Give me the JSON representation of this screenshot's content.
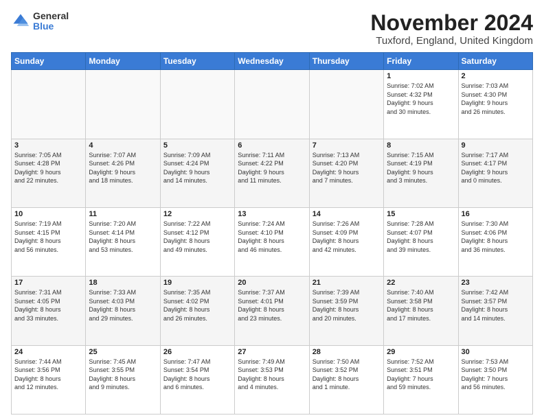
{
  "header": {
    "logo_general": "General",
    "logo_blue": "Blue",
    "month_title": "November 2024",
    "location": "Tuxford, England, United Kingdom"
  },
  "calendar": {
    "days_of_week": [
      "Sunday",
      "Monday",
      "Tuesday",
      "Wednesday",
      "Thursday",
      "Friday",
      "Saturday"
    ],
    "weeks": [
      [
        {
          "day": "",
          "info": ""
        },
        {
          "day": "",
          "info": ""
        },
        {
          "day": "",
          "info": ""
        },
        {
          "day": "",
          "info": ""
        },
        {
          "day": "",
          "info": ""
        },
        {
          "day": "1",
          "info": "Sunrise: 7:02 AM\nSunset: 4:32 PM\nDaylight: 9 hours\nand 30 minutes."
        },
        {
          "day": "2",
          "info": "Sunrise: 7:03 AM\nSunset: 4:30 PM\nDaylight: 9 hours\nand 26 minutes."
        }
      ],
      [
        {
          "day": "3",
          "info": "Sunrise: 7:05 AM\nSunset: 4:28 PM\nDaylight: 9 hours\nand 22 minutes."
        },
        {
          "day": "4",
          "info": "Sunrise: 7:07 AM\nSunset: 4:26 PM\nDaylight: 9 hours\nand 18 minutes."
        },
        {
          "day": "5",
          "info": "Sunrise: 7:09 AM\nSunset: 4:24 PM\nDaylight: 9 hours\nand 14 minutes."
        },
        {
          "day": "6",
          "info": "Sunrise: 7:11 AM\nSunset: 4:22 PM\nDaylight: 9 hours\nand 11 minutes."
        },
        {
          "day": "7",
          "info": "Sunrise: 7:13 AM\nSunset: 4:20 PM\nDaylight: 9 hours\nand 7 minutes."
        },
        {
          "day": "8",
          "info": "Sunrise: 7:15 AM\nSunset: 4:19 PM\nDaylight: 9 hours\nand 3 minutes."
        },
        {
          "day": "9",
          "info": "Sunrise: 7:17 AM\nSunset: 4:17 PM\nDaylight: 9 hours\nand 0 minutes."
        }
      ],
      [
        {
          "day": "10",
          "info": "Sunrise: 7:19 AM\nSunset: 4:15 PM\nDaylight: 8 hours\nand 56 minutes."
        },
        {
          "day": "11",
          "info": "Sunrise: 7:20 AM\nSunset: 4:14 PM\nDaylight: 8 hours\nand 53 minutes."
        },
        {
          "day": "12",
          "info": "Sunrise: 7:22 AM\nSunset: 4:12 PM\nDaylight: 8 hours\nand 49 minutes."
        },
        {
          "day": "13",
          "info": "Sunrise: 7:24 AM\nSunset: 4:10 PM\nDaylight: 8 hours\nand 46 minutes."
        },
        {
          "day": "14",
          "info": "Sunrise: 7:26 AM\nSunset: 4:09 PM\nDaylight: 8 hours\nand 42 minutes."
        },
        {
          "day": "15",
          "info": "Sunrise: 7:28 AM\nSunset: 4:07 PM\nDaylight: 8 hours\nand 39 minutes."
        },
        {
          "day": "16",
          "info": "Sunrise: 7:30 AM\nSunset: 4:06 PM\nDaylight: 8 hours\nand 36 minutes."
        }
      ],
      [
        {
          "day": "17",
          "info": "Sunrise: 7:31 AM\nSunset: 4:05 PM\nDaylight: 8 hours\nand 33 minutes."
        },
        {
          "day": "18",
          "info": "Sunrise: 7:33 AM\nSunset: 4:03 PM\nDaylight: 8 hours\nand 29 minutes."
        },
        {
          "day": "19",
          "info": "Sunrise: 7:35 AM\nSunset: 4:02 PM\nDaylight: 8 hours\nand 26 minutes."
        },
        {
          "day": "20",
          "info": "Sunrise: 7:37 AM\nSunset: 4:01 PM\nDaylight: 8 hours\nand 23 minutes."
        },
        {
          "day": "21",
          "info": "Sunrise: 7:39 AM\nSunset: 3:59 PM\nDaylight: 8 hours\nand 20 minutes."
        },
        {
          "day": "22",
          "info": "Sunrise: 7:40 AM\nSunset: 3:58 PM\nDaylight: 8 hours\nand 17 minutes."
        },
        {
          "day": "23",
          "info": "Sunrise: 7:42 AM\nSunset: 3:57 PM\nDaylight: 8 hours\nand 14 minutes."
        }
      ],
      [
        {
          "day": "24",
          "info": "Sunrise: 7:44 AM\nSunset: 3:56 PM\nDaylight: 8 hours\nand 12 minutes."
        },
        {
          "day": "25",
          "info": "Sunrise: 7:45 AM\nSunset: 3:55 PM\nDaylight: 8 hours\nand 9 minutes."
        },
        {
          "day": "26",
          "info": "Sunrise: 7:47 AM\nSunset: 3:54 PM\nDaylight: 8 hours\nand 6 minutes."
        },
        {
          "day": "27",
          "info": "Sunrise: 7:49 AM\nSunset: 3:53 PM\nDaylight: 8 hours\nand 4 minutes."
        },
        {
          "day": "28",
          "info": "Sunrise: 7:50 AM\nSunset: 3:52 PM\nDaylight: 8 hours\nand 1 minute."
        },
        {
          "day": "29",
          "info": "Sunrise: 7:52 AM\nSunset: 3:51 PM\nDaylight: 7 hours\nand 59 minutes."
        },
        {
          "day": "30",
          "info": "Sunrise: 7:53 AM\nSunset: 3:50 PM\nDaylight: 7 hours\nand 56 minutes."
        }
      ]
    ]
  }
}
